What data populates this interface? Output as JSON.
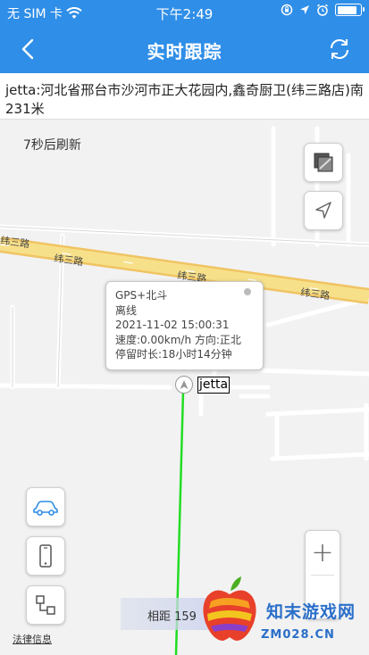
{
  "status_bar": {
    "carrier": "无 SIM 卡",
    "time": "下午2:49",
    "battery_level": 0.9
  },
  "nav": {
    "title": "实时跟踪"
  },
  "address": "jetta:河北省邢台市沙河市正大花园内,鑫奇厨卫(纬三路店)南231米",
  "map": {
    "refresh_countdown": "7秒后刷新",
    "road_labels": [
      "纬三路",
      "纬三路",
      "纬三路",
      "纬三路"
    ],
    "track_color": "#22dd22",
    "popup": {
      "line1": "GPS+北斗",
      "line2": "离线",
      "line3": "2021-11-02 15:00:31",
      "line4": "速度:0.00km/h 方向:正北",
      "line5": "停留时长:18小时14分钟"
    },
    "device_label": "jetta",
    "distance_text": "相距 159",
    "legal_link": "法律信息",
    "zoom_in_label": "+",
    "controls": {
      "layers_icon": "layers-icon",
      "locate_icon": "navigation-arrow-icon",
      "car_icon": "car-icon",
      "phone_icon": "phone-icon",
      "route_icon": "route-icon"
    }
  },
  "watermark": {
    "text": "知末游戏网",
    "url": "ZM028.CN"
  }
}
